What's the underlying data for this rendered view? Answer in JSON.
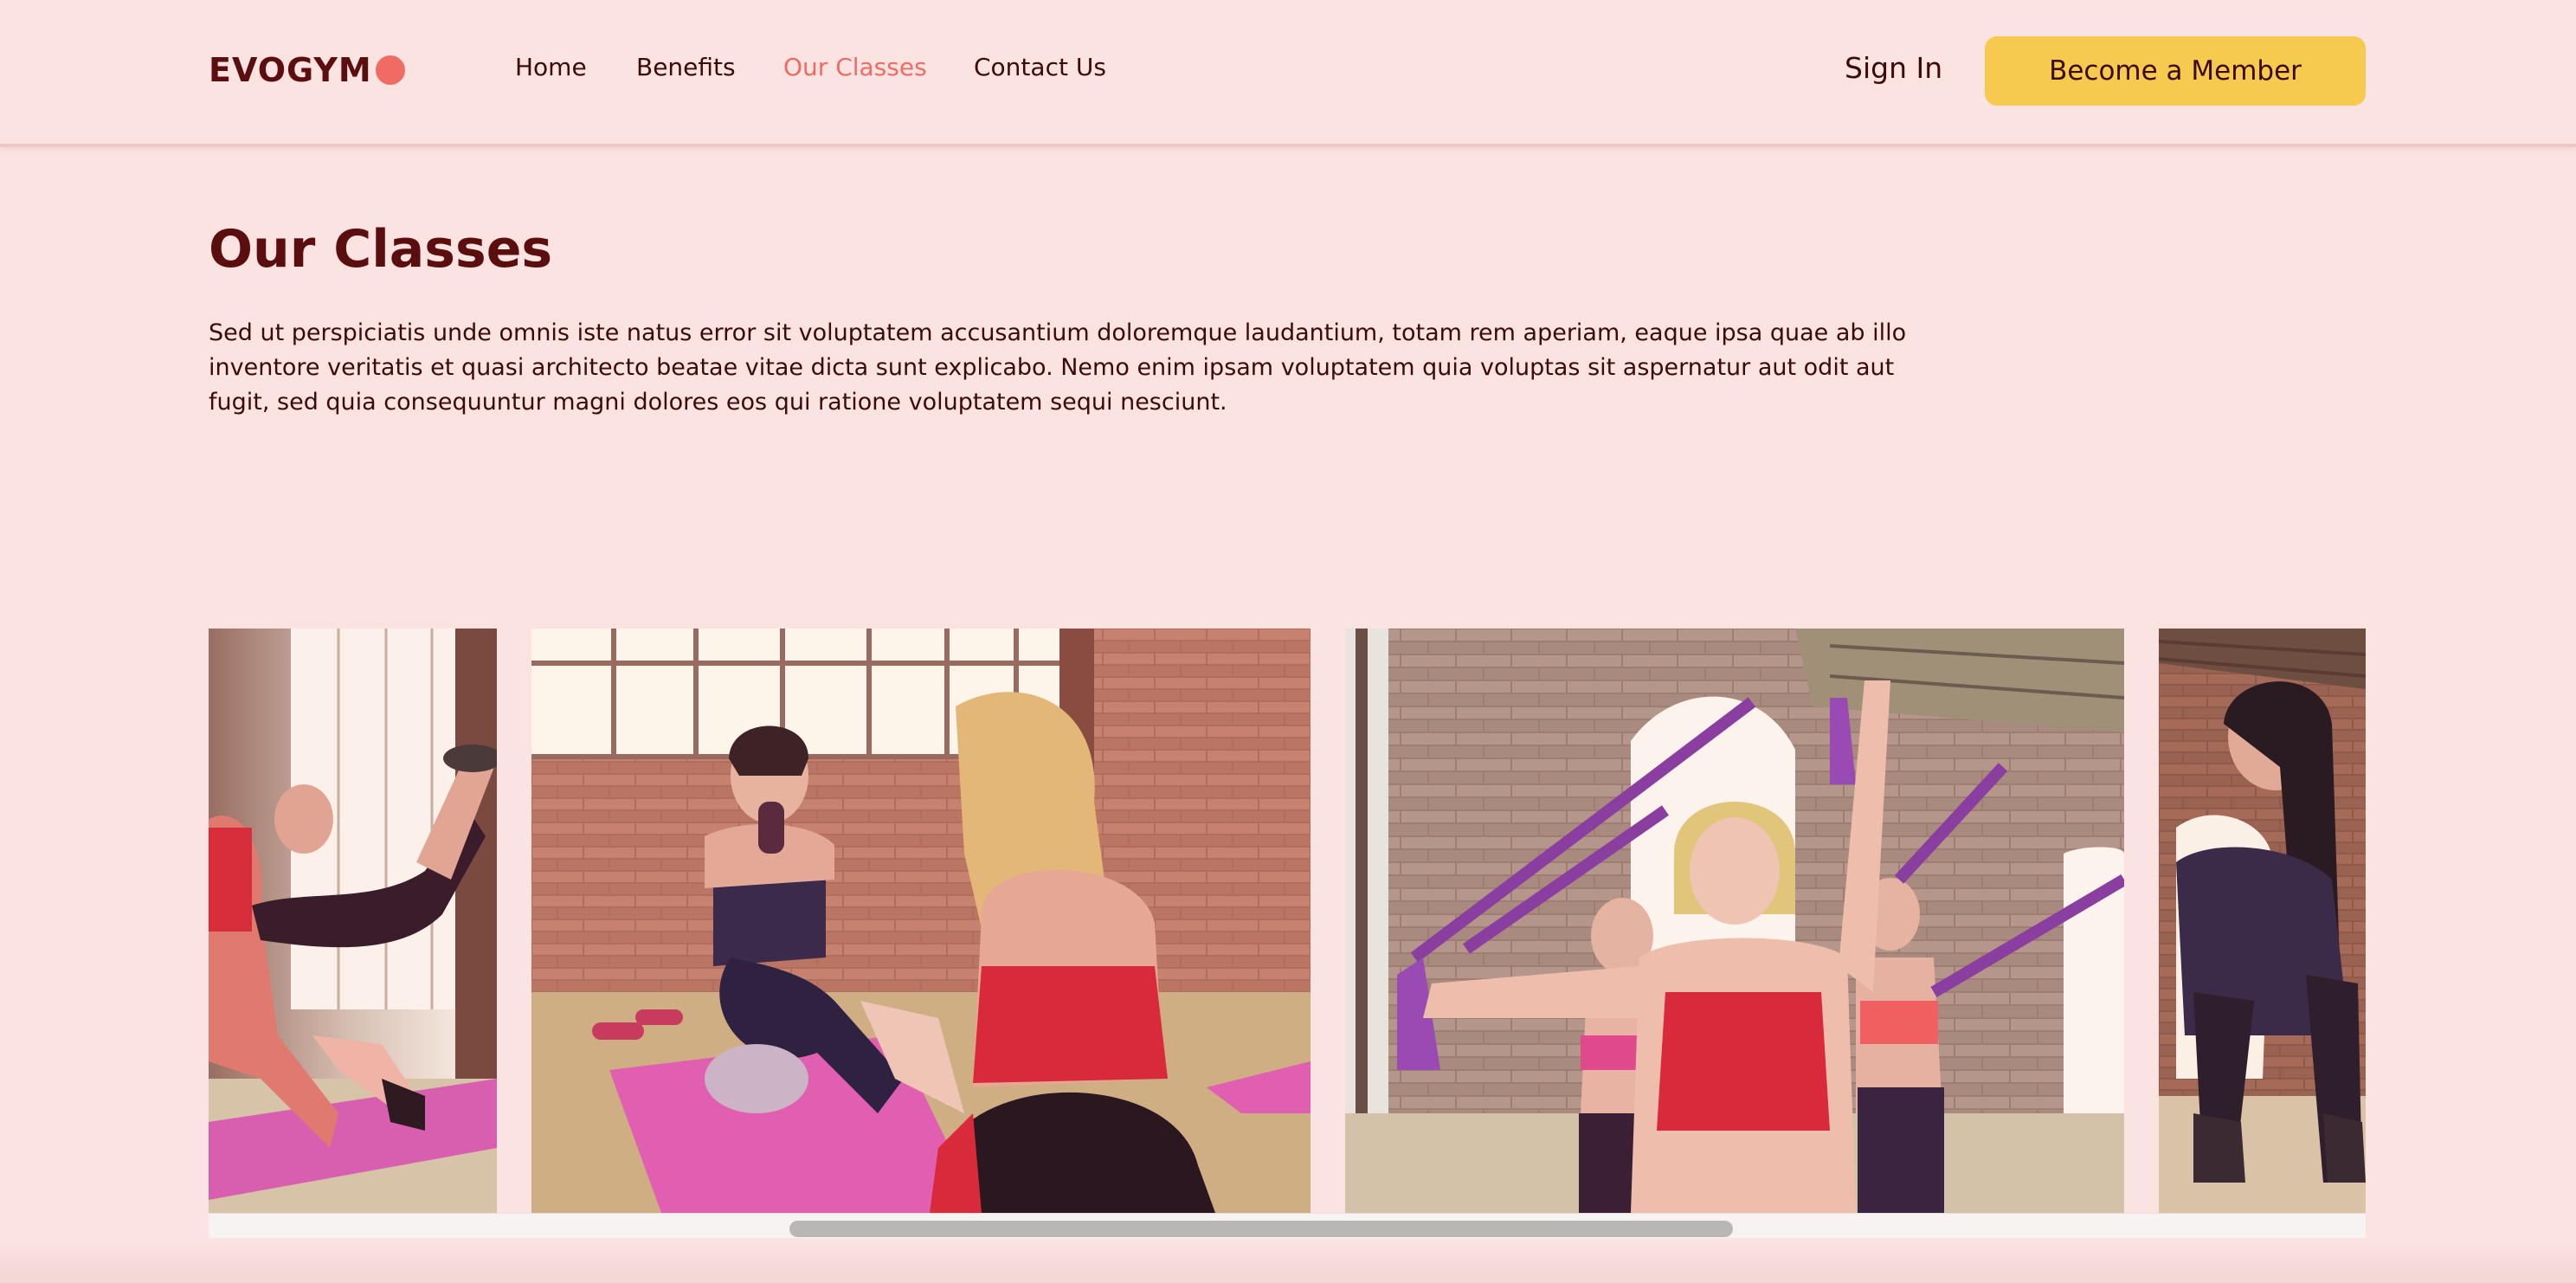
{
  "nav": {
    "logo": "EVOGYM",
    "links": [
      "Home",
      "Benefits",
      "Our Classes",
      "Contact Us"
    ],
    "active_index": 2,
    "sign_in": "Sign In",
    "cta": "Become a Member"
  },
  "main": {
    "title": "Our Classes",
    "description": "Sed ut perspiciatis unde omnis iste natus error sit voluptatem accusantium doloremque laudantium, totam rem aperiam, eaque ipsa quae ab illo inventore veritatis et quasi architecto beatae vitae dicta sunt explicabo. Nemo enim ipsam voluptatem quia voluptas sit aspernatur aut odit aut fugit, sed quia consequuntur magni dolores eos qui ratione voluptatem sequi nesciunt."
  },
  "colors": {
    "background": "#fbe3e2",
    "primary_dark": "#5b0e0e",
    "accent_red": "#f06b64",
    "cta_yellow": "#f6c94f"
  },
  "gallery": {
    "images": [
      "class-photo-1",
      "class-photo-2",
      "class-photo-3",
      "class-photo-4"
    ]
  }
}
